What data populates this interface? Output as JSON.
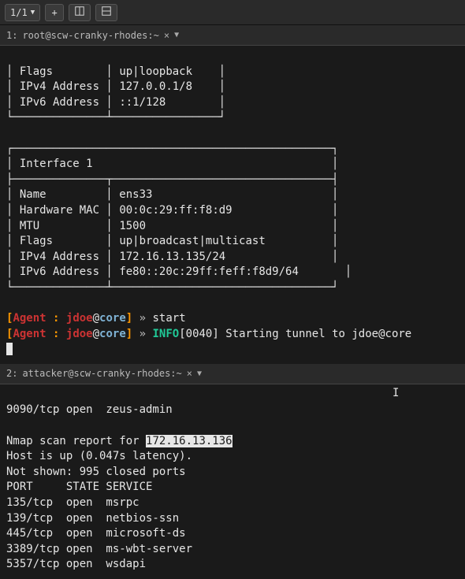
{
  "toolbar": {
    "counter": "1/1",
    "icons": [
      "plus",
      "layout1",
      "layout2",
      "layout3"
    ]
  },
  "tab1": {
    "index": "1:",
    "title": "root@scw-cranky-rhodes:~"
  },
  "pane1": {
    "iface0": {
      "flags_label": "Flags",
      "flags_value": "up|loopback",
      "ipv4_label": "IPv4 Address",
      "ipv4_value": "127.0.0.1/8",
      "ipv6_label": "IPv6 Address",
      "ipv6_value": "::1/128"
    },
    "iface1": {
      "header": "Interface 1",
      "name_label": "Name",
      "name_value": "ens33",
      "mac_label": "Hardware MAC",
      "mac_value": "00:0c:29:ff:f8:d9",
      "mtu_label": "MTU",
      "mtu_value": "1500",
      "flags_label": "Flags",
      "flags_value": "up|broadcast|multicast",
      "ipv4_label": "IPv4 Address",
      "ipv4_value": "172.16.13.135/24",
      "ipv6_label": "IPv6 Address",
      "ipv6_value": "fe80::20c:29ff:feff:f8d9/64"
    },
    "prompt": {
      "open": "[",
      "agent": "Agent",
      "sep": " : ",
      "user": "jdoe",
      "at": "@",
      "host": "core",
      "close": "]",
      "arrow": " » "
    },
    "cmd1": "start",
    "info_tag": "INFO",
    "info_time": "[0040]",
    "info_msg": " Starting tunnel to jdoe@core"
  },
  "tab2": {
    "index": "2:",
    "title": "attacker@scw-cranky-rhodes:~"
  },
  "pane2": {
    "top_line": "9090/tcp open  zeus-admin",
    "scan_prefix": "Nmap scan report for ",
    "scan_ip": "172.16.13.136",
    "host_line": "Host is up (0.047s latency).",
    "notshown_line": "Not shown: 995 closed ports",
    "hdr": "PORT     STATE SERVICE",
    "rows": [
      "135/tcp  open  msrpc",
      "139/tcp  open  netbios-ssn",
      "445/tcp  open  microsoft-ds",
      "3389/tcp open  ms-wbt-server",
      "5357/tcp open  wsdapi"
    ]
  }
}
